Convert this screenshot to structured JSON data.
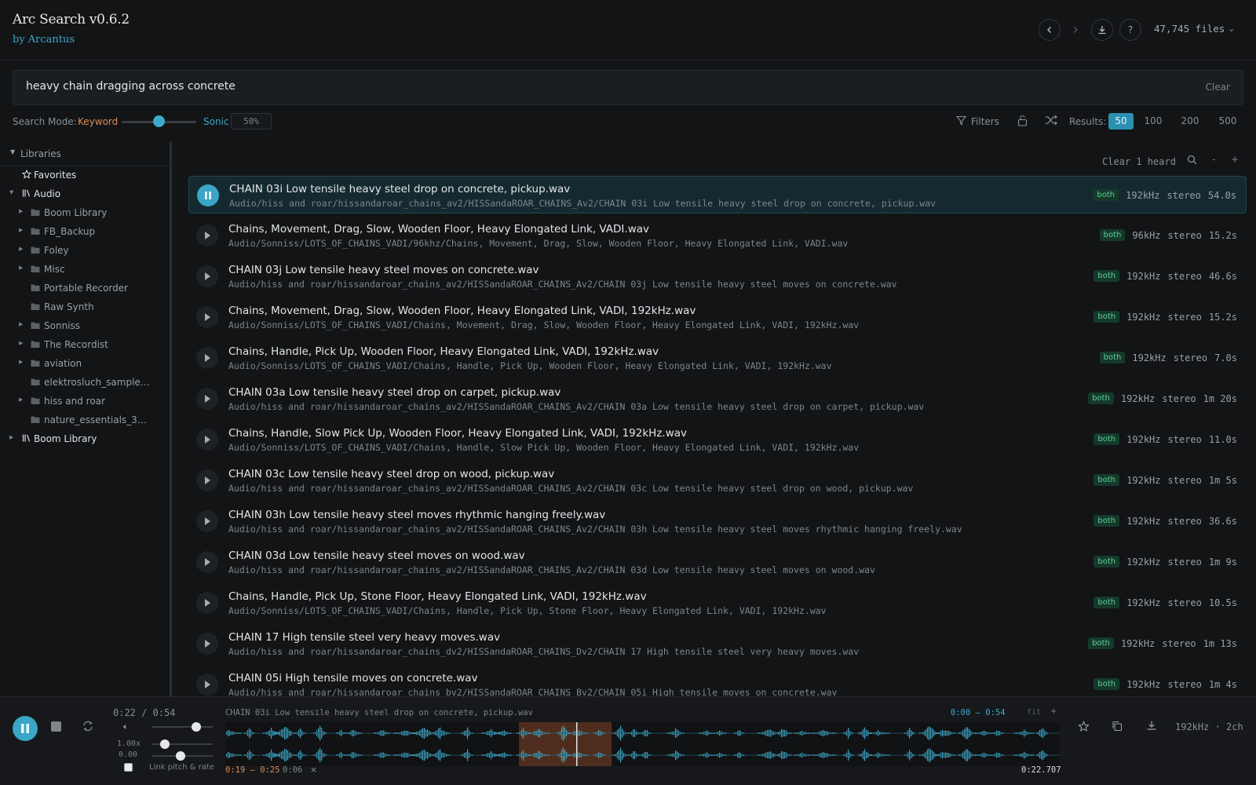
{
  "header": {
    "title": "Arc Search v0.6.2",
    "subtitle": "by Arcantus",
    "files_count": "47,745 files",
    "help_label": "?"
  },
  "search": {
    "query": "heavy chain dragging across concrete",
    "clear_label": "Clear"
  },
  "mode": {
    "label": "Search Mode:",
    "keyword_label": "Keyword",
    "sonic_label": "Sonic",
    "percent": "50%",
    "level": 0.5,
    "filters_label": "Filters",
    "results_label": "Results:",
    "results_options": [
      "50",
      "100",
      "200",
      "500"
    ],
    "results_selected": "50"
  },
  "colors": {
    "accent": "#3ba6c6",
    "keyword": "#e08a4d",
    "badge_bg": "#153a2c",
    "badge_text": "#5fcf97"
  },
  "sidebar": {
    "header_label": "Libraries",
    "items": [
      {
        "label": "Favorites",
        "icon": "star-icon",
        "level": 0,
        "caret": "",
        "strong": true
      },
      {
        "label": "Audio",
        "icon": "library-icon",
        "level": 0,
        "caret": "down",
        "strong": true
      },
      {
        "label": "Boom Library",
        "icon": "folder-icon",
        "level": 1,
        "caret": "right"
      },
      {
        "label": "FB_Backup",
        "icon": "folder-icon",
        "level": 1,
        "caret": "right"
      },
      {
        "label": "Foley",
        "icon": "folder-icon",
        "level": 1,
        "caret": "right"
      },
      {
        "label": "Misc",
        "icon": "folder-icon",
        "level": 1,
        "caret": "right"
      },
      {
        "label": "Portable Recorder",
        "icon": "folder-icon",
        "level": 1,
        "caret": ""
      },
      {
        "label": "Raw Synth",
        "icon": "folder-icon",
        "level": 1,
        "caret": ""
      },
      {
        "label": "Sonniss",
        "icon": "folder-icon",
        "level": 1,
        "caret": "right"
      },
      {
        "label": "The Recordist",
        "icon": "folder-icon",
        "level": 1,
        "caret": "right"
      },
      {
        "label": "aviation",
        "icon": "folder-icon",
        "level": 1,
        "caret": "right"
      },
      {
        "label": "elektrosluch_samplep…",
        "icon": "folder-icon",
        "level": 1,
        "caret": ""
      },
      {
        "label": "hiss and roar",
        "icon": "folder-icon",
        "level": 1,
        "caret": "right"
      },
      {
        "label": "nature_essentials_315…",
        "icon": "folder-icon",
        "level": 1,
        "caret": ""
      },
      {
        "label": "Boom Library",
        "icon": "library-icon",
        "level": 0,
        "caret": "right",
        "strong": true
      }
    ]
  },
  "list_tools": {
    "clear_heard": "Clear 1 heard",
    "zoom_out": "-",
    "zoom_in": "+"
  },
  "results": [
    {
      "name": "CHAIN 03i Low tensile heavy steel drop on concrete, pickup.wav",
      "path": "Audio/hiss and roar/hissandaroar_chains_av2/HISSandaROAR_CHAINS_Av2/CHAIN 03i Low tensile heavy steel drop on concrete, pickup.wav",
      "badge": "both",
      "rate": "192kHz",
      "channels": "stereo",
      "duration": "54.0s",
      "playing": true
    },
    {
      "name": "Chains, Movement, Drag, Slow, Wooden Floor, Heavy Elongated Link, VADI.wav",
      "path": "Audio/Sonniss/LOTS_OF_CHAINS_VADI/96khz/Chains, Movement, Drag, Slow, Wooden Floor, Heavy Elongated Link, VADI.wav",
      "badge": "both",
      "rate": "96kHz",
      "channels": "stereo",
      "duration": "15.2s"
    },
    {
      "name": "CHAIN 03j Low tensile heavy steel moves on concrete.wav",
      "path": "Audio/hiss and roar/hissandaroar_chains_av2/HISSandaROAR_CHAINS_Av2/CHAIN 03j Low tensile heavy steel moves on concrete.wav",
      "badge": "both",
      "rate": "192kHz",
      "channels": "stereo",
      "duration": "46.6s"
    },
    {
      "name": "Chains, Movement, Drag, Slow, Wooden Floor, Heavy Elongated Link, VADI, 192kHz.wav",
      "path": "Audio/Sonniss/LOTS_OF_CHAINS_VADI/Chains, Movement, Drag, Slow, Wooden Floor, Heavy Elongated Link, VADI, 192kHz.wav",
      "badge": "both",
      "rate": "192kHz",
      "channels": "stereo",
      "duration": "15.2s"
    },
    {
      "name": "Chains, Handle, Pick Up, Wooden Floor, Heavy Elongated Link, VADI, 192kHz.wav",
      "path": "Audio/Sonniss/LOTS_OF_CHAINS_VADI/Chains, Handle, Pick Up, Wooden Floor, Heavy Elongated Link, VADI, 192kHz.wav",
      "badge": "both",
      "rate": "192kHz",
      "channels": "stereo",
      "duration": "7.0s"
    },
    {
      "name": "CHAIN 03a Low tensile heavy steel drop on carpet, pickup.wav",
      "path": "Audio/hiss and roar/hissandaroar_chains_av2/HISSandaROAR_CHAINS_Av2/CHAIN 03a Low tensile heavy steel drop on carpet, pickup.wav",
      "badge": "both",
      "rate": "192kHz",
      "channels": "stereo",
      "duration": "1m 20s"
    },
    {
      "name": "Chains, Handle, Slow Pick Up, Wooden Floor, Heavy Elongated Link, VADI, 192kHz.wav",
      "path": "Audio/Sonniss/LOTS_OF_CHAINS_VADI/Chains, Handle, Slow Pick Up, Wooden Floor, Heavy Elongated Link, VADI, 192kHz.wav",
      "badge": "both",
      "rate": "192kHz",
      "channels": "stereo",
      "duration": "11.0s"
    },
    {
      "name": "CHAIN 03c Low tensile heavy steel drop on wood, pickup.wav",
      "path": "Audio/hiss and roar/hissandaroar_chains_av2/HISSandaROAR_CHAINS_Av2/CHAIN 03c Low tensile heavy steel drop on wood, pickup.wav",
      "badge": "both",
      "rate": "192kHz",
      "channels": "stereo",
      "duration": "1m 5s"
    },
    {
      "name": "CHAIN 03h Low tensile heavy steel moves rhythmic hanging freely.wav",
      "path": "Audio/hiss and roar/hissandaroar_chains_av2/HISSandaROAR_CHAINS_Av2/CHAIN 03h Low tensile heavy steel moves rhythmic hanging freely.wav",
      "badge": "both",
      "rate": "192kHz",
      "channels": "stereo",
      "duration": "36.6s"
    },
    {
      "name": "CHAIN 03d Low tensile heavy steel moves on wood.wav",
      "path": "Audio/hiss and roar/hissandaroar_chains_av2/HISSandaROAR_CHAINS_Av2/CHAIN 03d Low tensile heavy steel moves on wood.wav",
      "badge": "both",
      "rate": "192kHz",
      "channels": "stereo",
      "duration": "1m 9s"
    },
    {
      "name": "Chains, Handle, Pick Up, Stone Floor, Heavy Elongated Link, VADI, 192kHz.wav",
      "path": "Audio/Sonniss/LOTS_OF_CHAINS_VADI/Chains, Handle, Pick Up, Stone Floor, Heavy Elongated Link, VADI, 192kHz.wav",
      "badge": "both",
      "rate": "192kHz",
      "channels": "stereo",
      "duration": "10.5s"
    },
    {
      "name": "CHAIN 17 High tensile steel very heavy moves.wav",
      "path": "Audio/hiss and roar/hissandaroar_chains_dv2/HISSandaROAR_CHAINS_Dv2/CHAIN 17 High tensile steel very heavy moves.wav",
      "badge": "both",
      "rate": "192kHz",
      "channels": "stereo",
      "duration": "1m 13s"
    },
    {
      "name": "CHAIN 05i High tensile moves on concrete.wav",
      "path": "Audio/hiss and roar/hissandaroar_chains_bv2/HISSandaROAR_CHAINS_Bv2/CHAIN 05i High tensile moves on concrete.wav",
      "badge": "both",
      "rate": "192kHz",
      "channels": "stereo",
      "duration": "1m 4s"
    }
  ],
  "player": {
    "time": "0:22 / 0:54",
    "rate": "1.00x",
    "pitch": "0.00",
    "link_label": "Link pitch & rate",
    "track_title": "CHAIN 03i Low tensile heavy steel drop on concrete, pickup.wav",
    "view_range": "0:00 – 0:54",
    "fit_label": "fit",
    "zoom_plus": "+",
    "selection_range": "0:19 – 0:25",
    "selection_length": "0:06",
    "selection_close": "×",
    "position": "0:22.707",
    "format": "192kHz · 2ch",
    "duration_s": 54,
    "current_s": 22.707,
    "selection_start_s": 19,
    "selection_end_s": 25
  }
}
